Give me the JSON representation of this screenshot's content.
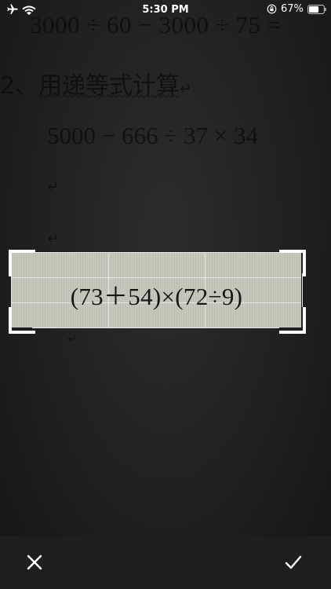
{
  "status_bar": {
    "time": "5:30 PM",
    "battery_percent": "67%",
    "icons": [
      "airplane-icon",
      "wifi-icon",
      "orientation-lock-icon",
      "battery-icon"
    ],
    "battery_level": 0.67
  },
  "photo": {
    "line_1": "3000 ÷ 60 − 3000 ÷ 75 =",
    "line_2_prefix": "2、",
    "line_2_text": "用递等式计算",
    "line_2_mark": "↵",
    "line_3": "5000 − 666 ÷ 37 × 34",
    "return_mark": "↵",
    "small_mark": "↵"
  },
  "crop": {
    "expression": "(73＋54)×(72÷9)"
  },
  "toolbar": {
    "cancel_icon": "close-icon",
    "confirm_icon": "checkmark-icon"
  },
  "colors": {
    "background": "#1b1b1b",
    "toolbar": "#1e1e1e",
    "crop_fill": "#c6c6ba",
    "handles": "#ffffff"
  }
}
